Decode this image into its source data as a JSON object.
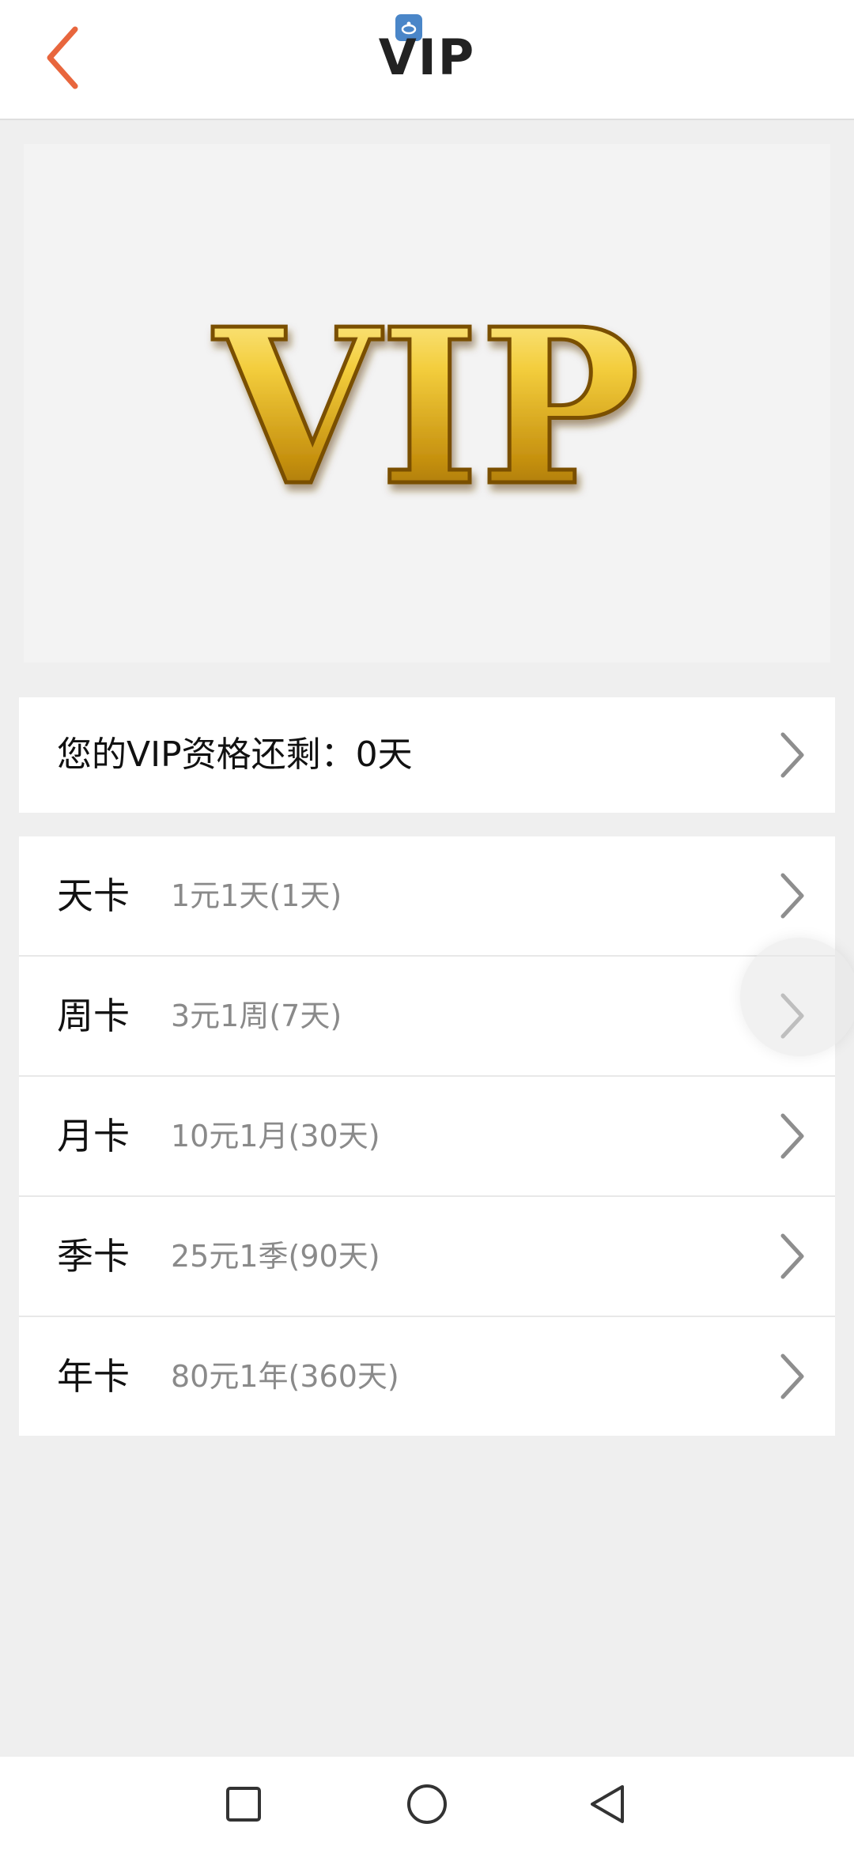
{
  "header": {
    "title": "VIP",
    "back_icon": "chevron-left-icon",
    "badge_icon": "app-badge-icon"
  },
  "banner": {
    "logo_text": "VIP"
  },
  "remaining": {
    "label": "您的VIP资格还剩：0天"
  },
  "plans": [
    {
      "name": "天卡",
      "desc": "1元1天(1天)"
    },
    {
      "name": "周卡",
      "desc": "3元1周(7天)"
    },
    {
      "name": "月卡",
      "desc": "10元1月(30天)"
    },
    {
      "name": "季卡",
      "desc": "25元1季(90天)"
    },
    {
      "name": "年卡",
      "desc": "80元1年(360天)"
    }
  ],
  "navbar": {
    "recent_icon": "square-icon",
    "home_icon": "circle-icon",
    "back_icon": "triangle-back-icon"
  },
  "colors": {
    "accent": "#e8663d",
    "background": "#efefef",
    "secondary_text": "#8a8a8a",
    "gold": "#d9a514"
  }
}
